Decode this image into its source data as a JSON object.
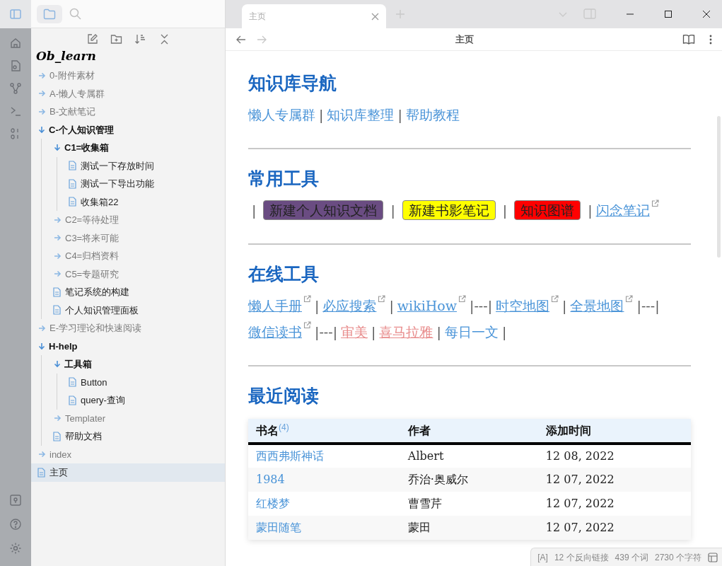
{
  "sidebar": {
    "vault_name": "Ob_learn",
    "tree": [
      {
        "kind": "folder",
        "label": "0-附件素材",
        "expanded": false
      },
      {
        "kind": "folder",
        "label": "A-懒人专属群",
        "expanded": false
      },
      {
        "kind": "folder",
        "label": "B-文献笔记",
        "expanded": false
      },
      {
        "kind": "folder",
        "label": "C-个人知识管理",
        "expanded": true,
        "children": [
          {
            "kind": "folder",
            "label": "C1=收集箱",
            "expanded": true,
            "children": [
              {
                "kind": "file",
                "label": "测试一下存放时间",
                "selected": false
              },
              {
                "kind": "file",
                "label": "测试一下导出功能",
                "selected": false
              },
              {
                "kind": "file",
                "label": "收集箱22",
                "selected": false
              }
            ]
          },
          {
            "kind": "folder",
            "label": "C2=等待处理",
            "expanded": false
          },
          {
            "kind": "folder",
            "label": "C3=将来可能",
            "expanded": false
          },
          {
            "kind": "folder",
            "label": "C4=归档资料",
            "expanded": false
          },
          {
            "kind": "folder",
            "label": "C5=专题研究",
            "expanded": false
          },
          {
            "kind": "file",
            "label": "笔记系统的构建",
            "selected": false
          },
          {
            "kind": "file",
            "label": "个人知识管理面板",
            "selected": false
          }
        ]
      },
      {
        "kind": "folder",
        "label": "E-学习理论和快速阅读",
        "expanded": false
      },
      {
        "kind": "folder",
        "label": "H-help",
        "expanded": true,
        "children": [
          {
            "kind": "folder",
            "label": "工具箱",
            "expanded": true,
            "children": [
              {
                "kind": "file",
                "label": "Button",
                "selected": false
              },
              {
                "kind": "file",
                "label": "query-查询",
                "selected": false
              }
            ]
          },
          {
            "kind": "folder",
            "label": "Templater",
            "expanded": false
          },
          {
            "kind": "file",
            "label": "帮助文档",
            "selected": false
          }
        ]
      },
      {
        "kind": "folder",
        "label": "index",
        "expanded": false
      },
      {
        "kind": "file",
        "label": "主页",
        "selected": true
      }
    ]
  },
  "tabs": [
    {
      "label": "主页",
      "selected": true
    }
  ],
  "view_header": {
    "title": "主页"
  },
  "sections": [
    {
      "heading": "知识库导航",
      "paragraph": [
        {
          "kind": "link",
          "text": "懒人专属群"
        },
        {
          "kind": "text",
          "text": "|"
        },
        {
          "kind": "link",
          "text": "知识库整理"
        },
        {
          "kind": "text",
          "text": "|"
        },
        {
          "kind": "link",
          "text": "帮助教程"
        }
      ]
    },
    {
      "heading": "常用工具",
      "paragraph": [
        {
          "kind": "text",
          "text": "|"
        },
        {
          "kind": "button",
          "text": "新建个人知识文档",
          "color": "#6a4c82"
        },
        {
          "kind": "text",
          "text": "|"
        },
        {
          "kind": "button",
          "text": "新建书影笔记",
          "color": "#ffff00"
        },
        {
          "kind": "text",
          "text": "|"
        },
        {
          "kind": "button",
          "text": "知识图谱",
          "color": "#ff0000"
        },
        {
          "kind": "text",
          "text": "|"
        },
        {
          "kind": "external",
          "text": "闪念笔记"
        }
      ]
    },
    {
      "heading": "在线工具",
      "paragraph": [
        {
          "kind": "external",
          "text": "懒人手册"
        },
        {
          "kind": "text",
          "text": "|"
        },
        {
          "kind": "external",
          "text": "必应搜索"
        },
        {
          "kind": "text",
          "text": "|"
        },
        {
          "kind": "external",
          "text": "wikiHow"
        },
        {
          "kind": "text",
          "text": "|---|"
        },
        {
          "kind": "external",
          "text": "时空地图"
        },
        {
          "kind": "text",
          "text": "|"
        },
        {
          "kind": "external",
          "text": "全景地图"
        },
        {
          "kind": "text",
          "text": "|---|"
        },
        {
          "kind": "external",
          "text": "微信读书"
        },
        {
          "kind": "text",
          "text": "|---|"
        },
        {
          "kind": "unresolved",
          "text": "审美"
        },
        {
          "kind": "text",
          "text": "|"
        },
        {
          "kind": "unresolved",
          "text": "喜马拉雅"
        },
        {
          "kind": "text",
          "text": "|"
        },
        {
          "kind": "link",
          "text": "每日一文"
        },
        {
          "kind": "text",
          "text": "|"
        }
      ]
    },
    {
      "heading": "最近阅读",
      "table": {
        "columns": [
          "书名$^{(4)}$",
          "作者",
          "添加时间"
        ],
        "rows": [
          [
            "西西弗斯神话",
            "Albert",
            "12 08, 2022"
          ],
          [
            "1984",
            "乔治·奥威尔",
            "12 07, 2022"
          ],
          [
            "红楼梦",
            "曹雪芹",
            "12 07, 2022"
          ],
          [
            "蒙田随笔",
            "蒙田",
            "12 07, 2022"
          ]
        ]
      }
    }
  ],
  "status_bar": [
    "[A]",
    "12 个反向链接",
    "439 个词",
    "2730 个字符"
  ]
}
